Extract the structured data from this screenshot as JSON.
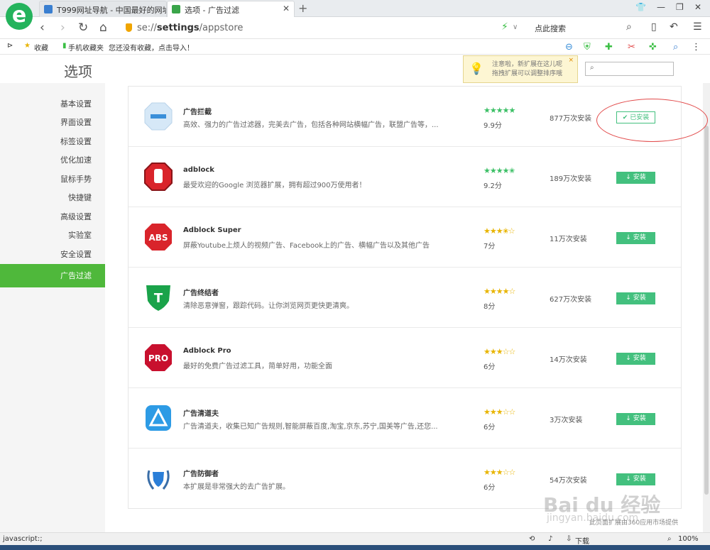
{
  "tabs": [
    {
      "label": "T999网址导航 - 中国最好的网址",
      "color": "#3a7fd0"
    },
    {
      "label": "选项 - 广告过滤",
      "color": "#3aa54a"
    }
  ],
  "new_tab": "+",
  "address": {
    "url_prefix": "se://",
    "url_main": "settings",
    "url_suffix": "/appstore"
  },
  "search_engine": "点此搜索",
  "favbar": {
    "collect": "收藏",
    "mobile": "手机收藏夹",
    "hint": "您还没有收藏，点击导入！"
  },
  "header": {
    "title": "选项"
  },
  "tip": {
    "line1": "注意啦，新扩展在这儿呢",
    "line2": "拖拽扩展可以调整排序哦",
    "close": "×"
  },
  "sidebar": {
    "items": [
      {
        "label": "基本设置"
      },
      {
        "label": "界面设置"
      },
      {
        "label": "标签设置"
      },
      {
        "label": "优化加速"
      },
      {
        "label": "鼠标手势"
      },
      {
        "label": "快捷键"
      },
      {
        "label": "高级设置"
      },
      {
        "label": "实验室"
      },
      {
        "label": "安全设置"
      },
      {
        "label": "广告过滤"
      }
    ]
  },
  "extensions": [
    {
      "name": "广告拦截",
      "desc": "高效、强力的广告过滤器，完美去广告，包括各种网站横幅广告，联盟广告等，...",
      "stars": "★★★★★",
      "score": "9.9分",
      "installs": "877万次安装",
      "button": "✔ 已安装",
      "icon": "ad-block-icon"
    },
    {
      "name": "adblock",
      "desc": "最受欢迎的Google 浏览器扩展，拥有超过900万使用者！",
      "stars": "★★★★✬",
      "score": "9.2分",
      "installs": "189万次安装",
      "button": "↓ 安装",
      "icon": "stop-hand-icon"
    },
    {
      "name": "Adblock Super",
      "desc": "屏蔽Youtube上烦人的视频广告、Facebook上的广告、横幅广告以及其他广告",
      "stars": "★★★✬☆",
      "score": "7分",
      "installs": "11万次安装",
      "button": "↓ 安装",
      "icon": "abs-icon"
    },
    {
      "name": "广告终结者",
      "desc": "清除恶意弹窗，跟踪代码。让你浏览网页更快更清爽。",
      "stars": "★★★★☆",
      "score": "8分",
      "installs": "627万次安装",
      "button": "↓ 安装",
      "icon": "t-shield-icon"
    },
    {
      "name": "Adblock Pro",
      "desc": "最好的免费广告过滤工具，简单好用，功能全面",
      "stars": "★★★☆☆",
      "score": "6分",
      "installs": "14万次安装",
      "button": "↓ 安装",
      "icon": "pro-icon"
    },
    {
      "name": "广告清道夫",
      "desc": "广告清道夫，收集已知广告规则,智能屏蔽百度,淘宝,京东,苏宁,国美等广告,还您...",
      "stars": "★★★☆☆",
      "score": "6分",
      "installs": "3万次安装",
      "button": "↓ 安装",
      "icon": "triangle-icon"
    },
    {
      "name": "广告防御者",
      "desc": "本扩展是非常强大的去广告扩展。",
      "stars": "★★★☆☆",
      "score": "6分",
      "installs": "54万次安装",
      "button": "↓ 安装",
      "icon": "laurel-shield-icon"
    }
  ],
  "footer_note": "此页面扩展由360应用市场提供",
  "watermark": "Bai du 经验",
  "watermark_sub": "jingyan.baidu.com",
  "status": {
    "left": "javascript:;",
    "download": "下载",
    "zoom": "100%"
  }
}
